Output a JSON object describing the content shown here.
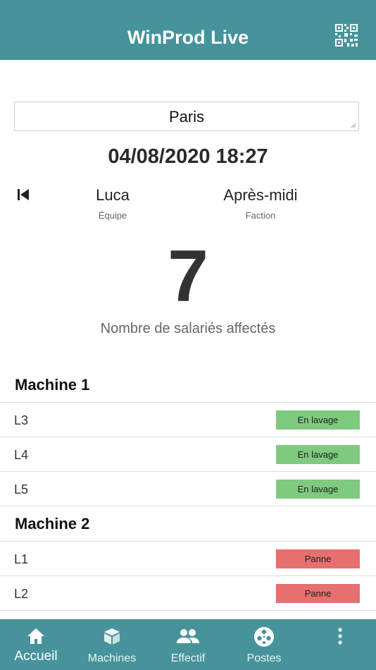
{
  "app": {
    "title": "WinProd Live",
    "header_color": "#47939b",
    "qr_icon": "qr-code-icon"
  },
  "site_select": {
    "value": "Paris"
  },
  "datetime": "04/08/2020 18:27",
  "shift": {
    "team_value": "Luca",
    "team_label": "Équipe",
    "faction_value": "Après-midi",
    "faction_label": "Faction"
  },
  "count": {
    "value": "7",
    "label": "Nombre de salariés affectés"
  },
  "machines": [
    {
      "name": "Machine 1",
      "lines": [
        {
          "label": "L3",
          "status": "En lavage",
          "status_color": "#7fca7f"
        },
        {
          "label": "L4",
          "status": "En lavage",
          "status_color": "#7fca7f"
        },
        {
          "label": "L5",
          "status": "En lavage",
          "status_color": "#7fca7f"
        }
      ]
    },
    {
      "name": "Machine 2",
      "lines": [
        {
          "label": "L1",
          "status": "Panne",
          "status_color": "#e5706f"
        },
        {
          "label": "L2",
          "status": "Panne",
          "status_color": "#e5706f"
        }
      ]
    }
  ],
  "bottom_nav": {
    "items": [
      {
        "label": "Accueil",
        "icon": "home-icon",
        "active": true
      },
      {
        "label": "Machines",
        "icon": "cube-icon",
        "active": false
      },
      {
        "label": "Effectif",
        "icon": "people-icon",
        "active": false
      },
      {
        "label": "Postes",
        "icon": "reel-icon",
        "active": false
      },
      {
        "label": "",
        "icon": "more-vertical-icon",
        "active": false
      }
    ]
  }
}
